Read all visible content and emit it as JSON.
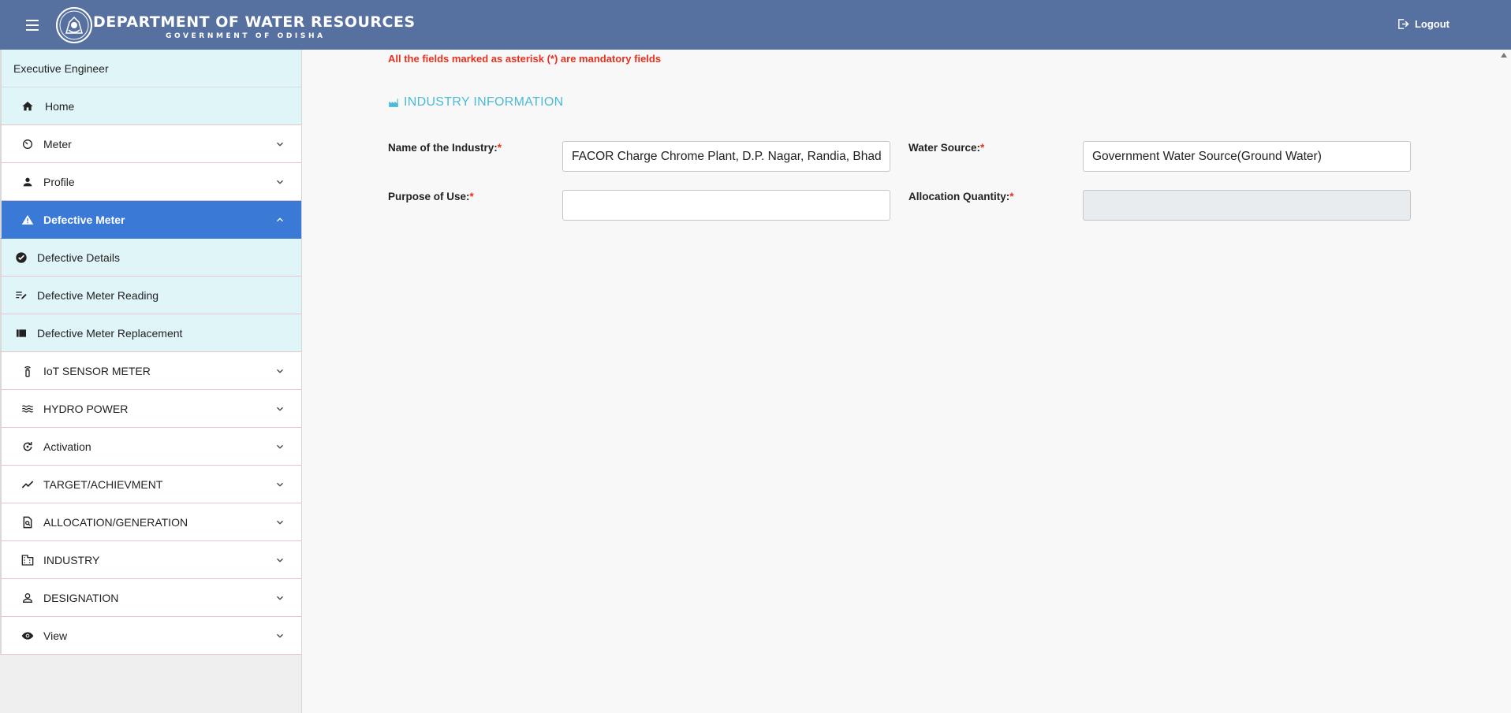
{
  "header": {
    "title": "DEPARTMENT OF WATER RESOURCES",
    "subtitle": "GOVERNMENT OF ODISHA",
    "logout_label": "Logout"
  },
  "sidebar": {
    "user_role": "Executive Engineer",
    "items": [
      {
        "label": "Home",
        "icon": "home-icon"
      },
      {
        "label": "Meter",
        "icon": "gauge-icon"
      },
      {
        "label": "Profile",
        "icon": "person-icon"
      },
      {
        "label": "Defective Meter",
        "icon": "warning-icon"
      },
      {
        "label": "Defective Details",
        "icon": "check-circle-icon"
      },
      {
        "label": "Defective Meter Reading",
        "icon": "edit-note-icon"
      },
      {
        "label": "Defective Meter Replacement",
        "icon": "view-list-icon"
      },
      {
        "label": "IoT SENSOR METER",
        "icon": "sensor-icon"
      },
      {
        "label": "HYDRO POWER",
        "icon": "waves-icon"
      },
      {
        "label": "Activation",
        "icon": "refresh-icon"
      },
      {
        "label": "TARGET/ACHIEVMENT",
        "icon": "trend-icon"
      },
      {
        "label": "ALLOCATION/GENERATION",
        "icon": "find-document-icon"
      },
      {
        "label": "INDUSTRY",
        "icon": "building-icon"
      },
      {
        "label": "DESIGNATION",
        "icon": "person-outline-icon"
      },
      {
        "label": "View",
        "icon": "eye-icon"
      }
    ]
  },
  "main": {
    "mandatory_note": "All the fields marked as asterisk (*) are mandatory fields",
    "section_title": "INDUSTRY INFORMATION",
    "asterisk": "*",
    "fields": {
      "industry_name": {
        "label": "Name of the Industry:",
        "value": "FACOR Charge Chrome Plant, D.P. Nagar, Randia, Bhadrak"
      },
      "water_source": {
        "label": "Water Source:",
        "value": "Government Water Source(Ground Water)"
      },
      "purpose": {
        "label": "Purpose of Use:",
        "value": ""
      },
      "allocation": {
        "label": "Allocation Quantity:",
        "value": ""
      }
    }
  },
  "colors": {
    "header_bg": "#5670a0",
    "active_item": "#3b79d6",
    "submenu_bg": "#e0f5f8",
    "required": "#e8301e",
    "section_title": "#4cbad6"
  }
}
